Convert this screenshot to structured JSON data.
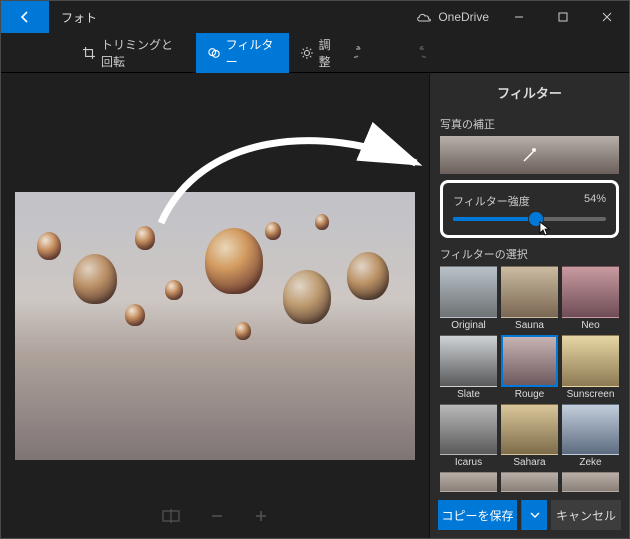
{
  "titlebar": {
    "app_name": "フォト",
    "onedrive": "OneDrive"
  },
  "toolbar": {
    "crop": "トリミングと回転",
    "filter": "フィルター",
    "adjust": "調整"
  },
  "panel": {
    "title": "フィルター",
    "enhance_label": "写真の補正",
    "strength_label": "フィルター強度",
    "strength_value": "54%",
    "strength_percent": 54,
    "filters_label": "フィルターの選択",
    "filters": [
      {
        "name": "Original",
        "tint": "linear-gradient(to bottom,#b9c2c8,#6e7275)"
      },
      {
        "name": "Sauna",
        "tint": "linear-gradient(to bottom,#cbbba1,#7a6753)"
      },
      {
        "name": "Neo",
        "tint": "linear-gradient(to bottom,#c99aa0,#6f4d57)"
      },
      {
        "name": "Slate",
        "tint": "linear-gradient(to bottom,#cfd2d4,#585a5c)"
      },
      {
        "name": "Rouge",
        "tint": "linear-gradient(to bottom,#c7b3b3,#6e5a5e)",
        "selected": true
      },
      {
        "name": "Sunscreen",
        "tint": "linear-gradient(to bottom,#e7d6a4,#8d7a54)"
      },
      {
        "name": "Icarus",
        "tint": "linear-gradient(to bottom,#b9b9b9,#5a5a5a)"
      },
      {
        "name": "Sahara",
        "tint": "linear-gradient(to bottom,#d9c69a,#7e6c4a)"
      },
      {
        "name": "Zeke",
        "tint": "linear-gradient(to bottom,#c3cedc,#5c6c80)"
      }
    ],
    "extra_row_count": 3
  },
  "footer": {
    "save": "コピーを保存",
    "cancel": "キャンセル"
  }
}
